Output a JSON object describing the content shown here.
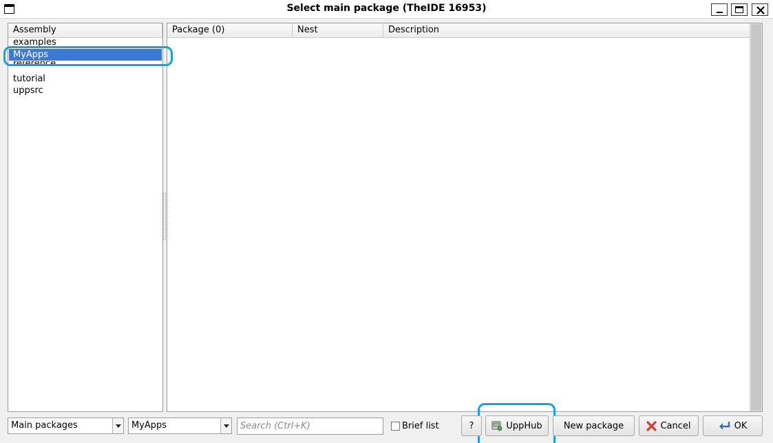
{
  "window": {
    "title": "Select main package (TheIDE 16953)"
  },
  "assembly": {
    "header": "Assembly",
    "items": [
      "examples",
      "MyApps",
      "reference",
      "tutorial",
      "uppsrc"
    ],
    "selected": "MyApps"
  },
  "packages": {
    "columns": [
      "Package (0)",
      "Nest",
      "Description"
    ]
  },
  "footer": {
    "filter_value": "Main packages",
    "assembly_value": "MyApps",
    "search_placeholder": "Search (Ctrl+K)",
    "brief_list_label": "Brief list",
    "help_label": "?",
    "upphub_label": "UppHub",
    "new_package_label": "New package",
    "cancel_label": "Cancel",
    "ok_label": "OK"
  },
  "colors": {
    "selection": "#3b79d8",
    "highlight_annotation": "#1aa0dc"
  }
}
